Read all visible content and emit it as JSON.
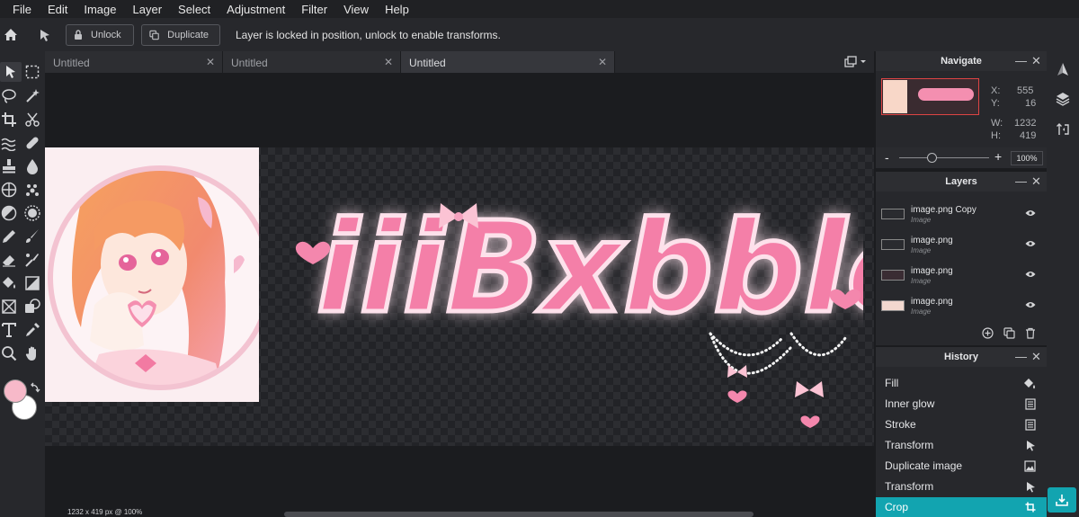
{
  "menu": [
    "File",
    "Edit",
    "Image",
    "Layer",
    "Select",
    "Adjustment",
    "Filter",
    "View",
    "Help"
  ],
  "options": {
    "unlock_label": "Unlock",
    "duplicate_label": "Duplicate",
    "message": "Layer is locked in position, unlock to enable transforms."
  },
  "tabs": [
    "Untitled",
    "Untitled",
    "Untitled"
  ],
  "canvas": {
    "artwork_text": "iiiBxbbles",
    "status": "1232 x 419 px @ 100%"
  },
  "navigate": {
    "title": "Navigate",
    "x_label": "X:",
    "x_value": "555",
    "y_label": "Y:",
    "y_value": "16",
    "w_label": "W:",
    "w_value": "1232",
    "h_label": "H:",
    "h_value": "419",
    "zoom": "100%",
    "zoom_minus": "-",
    "zoom_plus": "+"
  },
  "layers": {
    "title": "Layers",
    "items": [
      {
        "name": "image.png Copy",
        "type": "Image"
      },
      {
        "name": "image.png",
        "type": "Image"
      },
      {
        "name": "image.png",
        "type": "Image"
      },
      {
        "name": "image.png",
        "type": "Image"
      }
    ]
  },
  "history": {
    "title": "History",
    "items": [
      "Fill",
      "Inner glow",
      "Stroke",
      "Transform",
      "Duplicate image",
      "Transform",
      "Crop"
    ]
  },
  "colors": {
    "foreground": "#f7b9c9",
    "background": "#ffffff",
    "accent": "#12a4b0",
    "logo_pink": "#f47fa8"
  },
  "icons": [
    "home-icon",
    "arrow-icon",
    "lock-icon",
    "duplicate-icon",
    "layers-icon",
    "history-icon",
    "download-icon"
  ]
}
